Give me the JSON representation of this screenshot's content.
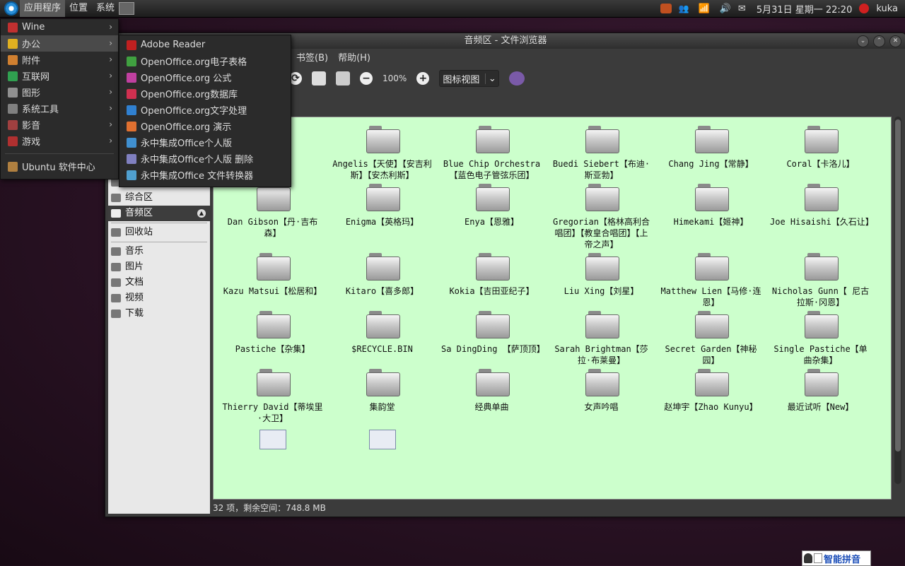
{
  "panel": {
    "menus": [
      "应用程序",
      "位置",
      "系统"
    ],
    "clock": "5月31日 星期一 22:20",
    "user": "kuka"
  },
  "window": {
    "title": "音频区 - 文件浏览器",
    "menubar": [
      "书签(B)",
      "帮助(H)"
    ],
    "zoom": "100%",
    "view_mode": "图标视图",
    "status": "32 项，剩余空间：748.8 MB"
  },
  "sidebar": {
    "items": [
      {
        "label": "Win 7",
        "icon": "drive-icon"
      },
      {
        "label": "综合区",
        "icon": "drive-icon"
      },
      {
        "label": "音频区",
        "icon": "drive-icon",
        "selected": true
      },
      {
        "label": "回收站",
        "icon": "trash-icon"
      },
      {
        "label": "音乐",
        "icon": "music-folder-icon"
      },
      {
        "label": "图片",
        "icon": "pictures-folder-icon"
      },
      {
        "label": "文档",
        "icon": "documents-folder-icon"
      },
      {
        "label": "视频",
        "icon": "videos-folder-icon"
      },
      {
        "label": "下载",
        "icon": "downloads-folder-icon"
      }
    ]
  },
  "files": [
    "【蜻",
    "Angelis【天使】【安吉利斯】【安杰利斯】",
    "Blue Chip Orchestra【蓝色电子管弦乐团】",
    "Buedi Siebert【布迪·斯亚勃】",
    "Chang Jing【常静】",
    "Coral【卡洛儿】",
    "Dan Gibson【丹·吉布森】",
    "Enigma【英格玛】",
    "Enya【恩雅】",
    "Gregorian【格林高利合唱团】【教皇合唱团】【上帝之声】",
    "Himekami【姬神】",
    "Joe Hisaishi【久石让】",
    "Kazu Matsui【松居和】",
    "Kitaro【喜多郎】",
    "Kokia【吉田亚纪子】",
    "Liu Xing【刘星】",
    "Matthew Lien【马修·连恩】",
    "Nicholas Gunn【 尼古拉斯·冈恩】",
    "Pastiche【杂集】",
    "$RECYCLE.BIN",
    "Sa DingDing 【萨顶顶】",
    "Sarah Brightman【莎拉·布莱曼】",
    "Secret Garden【神秘园】",
    "Single Pastiche【单曲杂集】",
    "Thierry David【蒂埃里·大卫】",
    "集韵堂",
    "经典单曲",
    "女声吟唱",
    "赵坤宇【Zhao Kunyu】",
    "最近试听【New】"
  ],
  "app_menu": [
    {
      "label": "Wine",
      "icon": "wine-icon",
      "color": "#c03030"
    },
    {
      "label": "办公",
      "icon": "office-icon",
      "color": "#e0b020",
      "highlight": true
    },
    {
      "label": "附件",
      "icon": "accessories-icon",
      "color": "#d08030"
    },
    {
      "label": "互联网",
      "icon": "internet-icon",
      "color": "#30a050"
    },
    {
      "label": "图形",
      "icon": "graphics-icon",
      "color": "#909090"
    },
    {
      "label": "系统工具",
      "icon": "system-tools-icon",
      "color": "#808080"
    },
    {
      "label": "影音",
      "icon": "multimedia-icon",
      "color": "#a04040"
    },
    {
      "label": "游戏",
      "icon": "games-icon",
      "color": "#b03030"
    }
  ],
  "app_menu_extra": {
    "label": "Ubuntu 软件中心",
    "icon": "software-center-icon"
  },
  "office_menu": [
    {
      "label": "Adobe Reader",
      "icon": "adobe-reader-icon",
      "color": "#c02020"
    },
    {
      "label": "OpenOffice.org电子表格",
      "icon": "spreadsheet-icon",
      "color": "#40a040"
    },
    {
      "label": "OpenOffice.org 公式",
      "icon": "formula-icon",
      "color": "#c040a0"
    },
    {
      "label": "OpenOffice.org数据库",
      "icon": "database-icon",
      "color": "#d03050"
    },
    {
      "label": "OpenOffice.org文字处理",
      "icon": "writer-icon",
      "color": "#3080d0"
    },
    {
      "label": "OpenOffice.org 演示",
      "icon": "impress-icon",
      "color": "#e07030"
    },
    {
      "label": "永中集成Office个人版",
      "icon": "eio-office-icon",
      "color": "#4090d0"
    },
    {
      "label": "永中集成Office个人版 删除",
      "icon": "eio-uninstall-icon",
      "color": "#8080c0"
    },
    {
      "label": "永中集成Office 文件转换器",
      "icon": "eio-converter-icon",
      "color": "#50a0d0"
    }
  ],
  "ime": "智能拼音"
}
